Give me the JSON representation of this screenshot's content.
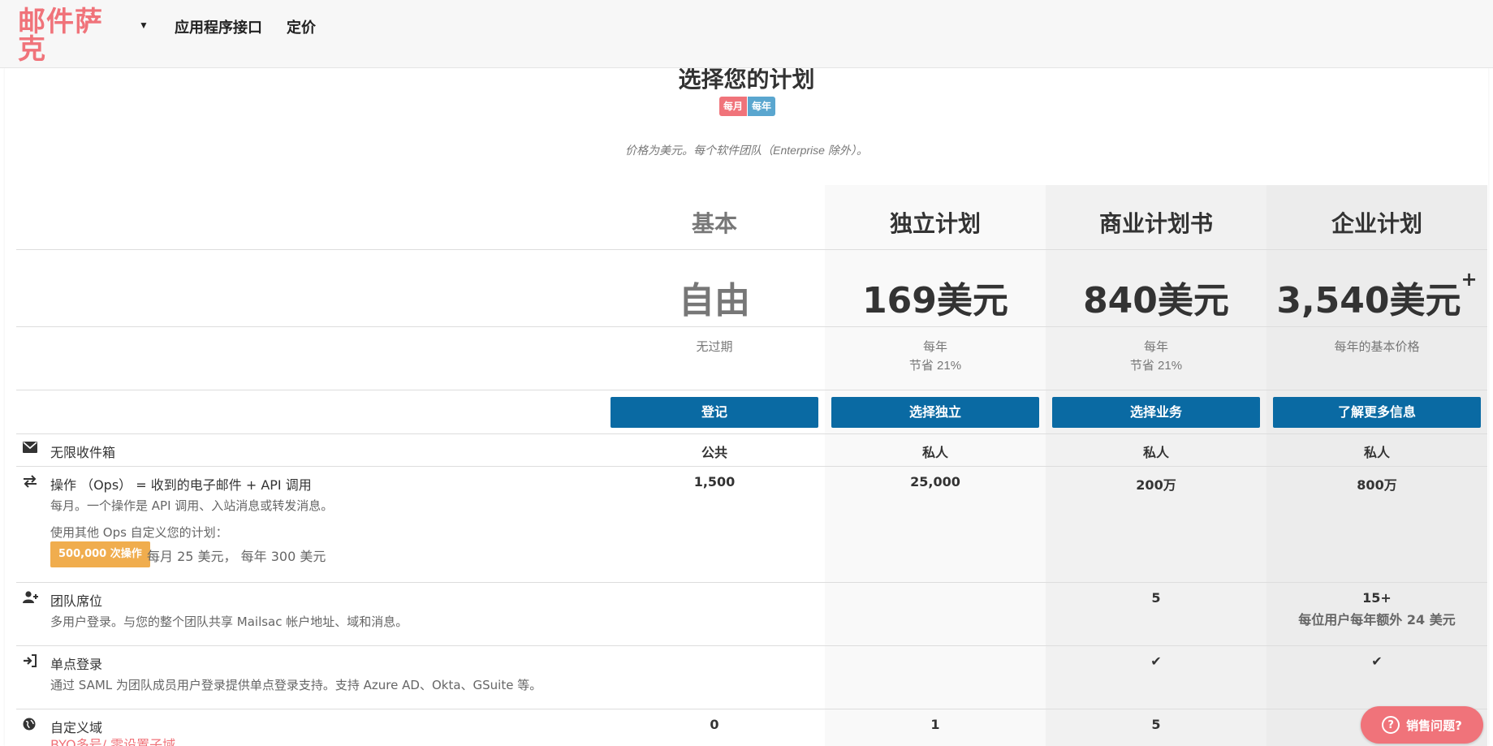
{
  "nav": {
    "logo": "邮件萨克",
    "caret": "▼",
    "links": [
      "应用程序接口",
      "定价"
    ]
  },
  "page": {
    "title": "选择您的计划",
    "toggle": {
      "monthly": "每月",
      "yearly": "每年"
    },
    "price_note": "价格为美元。每个软件团队（Enterprise 除外）。"
  },
  "plans": [
    {
      "name": "基本",
      "price": "自由",
      "price_sup": "",
      "note": [
        "无过期",
        ""
      ],
      "button": "登记"
    },
    {
      "name": "独立计划",
      "price": "169美元",
      "price_sup": "",
      "note": [
        "每年",
        "节省 21%"
      ],
      "button": "选择独立"
    },
    {
      "name": "商业计划书",
      "price": "840美元",
      "price_sup": "",
      "note": [
        "每年",
        "节省 21%"
      ],
      "button": "选择业务"
    },
    {
      "name": "企业计划",
      "price": "3,540美元",
      "price_sup": "+",
      "note": [
        "每年的基本价格",
        ""
      ],
      "button": "了解更多信息"
    }
  ],
  "features": {
    "inbox": {
      "icon": "envelope-icon",
      "title": "无限收件箱",
      "values": [
        "公共",
        "私人",
        "私人",
        "私人"
      ]
    },
    "ops": {
      "icon": "exchange-icon",
      "title": "操作 （Ops） = 收到的电子邮件 + API 调用",
      "desc": "每月。一个操作是 API 调用、入站消息或转发消息。",
      "custom_label": "使用其他 Ops 自定义您的计划：",
      "badge": "500,000 次操作",
      "badge_price": "每月 25 美元， 每年 300 美元",
      "values": [
        "1,500",
        "25,000",
        "200万",
        "800万"
      ]
    },
    "team": {
      "icon": "user-plus-icon",
      "title": "团队席位",
      "desc": "多用户登录。与您的整个团队共享 Mailsac 帐户地址、域和消息。",
      "values": [
        "",
        "",
        "5",
        "15+"
      ],
      "enterprise_sub": "每位用户每年额外 24 美元"
    },
    "sso": {
      "icon": "sign-in-icon",
      "title": "单点登录",
      "desc": "通过 SAML 为团队成员用户登录提供单点登录支持。支持 Azure AD、Okta、GSuite 等。",
      "values": [
        "",
        "",
        "✔",
        "✔"
      ]
    },
    "domain": {
      "icon": "globe-icon",
      "title": "自定义域",
      "link_a": "BYO多号",
      "link_sep": "/ ",
      "link_b": "零设置子域",
      "values": [
        "0",
        "1",
        "5",
        ""
      ]
    }
  },
  "sales": {
    "label": "销售问题?",
    "icon": "question-circle-icon"
  },
  "colors": {
    "brand": "#f0737a",
    "button": "#0a6aa3",
    "badge": "#f0ad4e",
    "yearly": "#5aa6cf"
  }
}
